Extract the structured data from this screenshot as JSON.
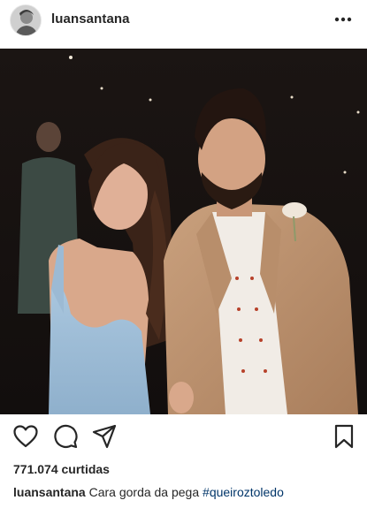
{
  "post": {
    "username": "luansantana",
    "likes_text": "771.074 curtidas",
    "caption": {
      "username": "luansantana",
      "text": "Cara gorda da pega",
      "hashtag": "#queiroztoledo"
    }
  },
  "icons": {
    "more": "more-horizontal-icon",
    "like": "heart-icon",
    "comment": "comment-icon",
    "share": "send-icon",
    "save": "bookmark-icon"
  },
  "colors": {
    "text": "#262626",
    "hashtag": "#003569",
    "background": "#ffffff"
  }
}
